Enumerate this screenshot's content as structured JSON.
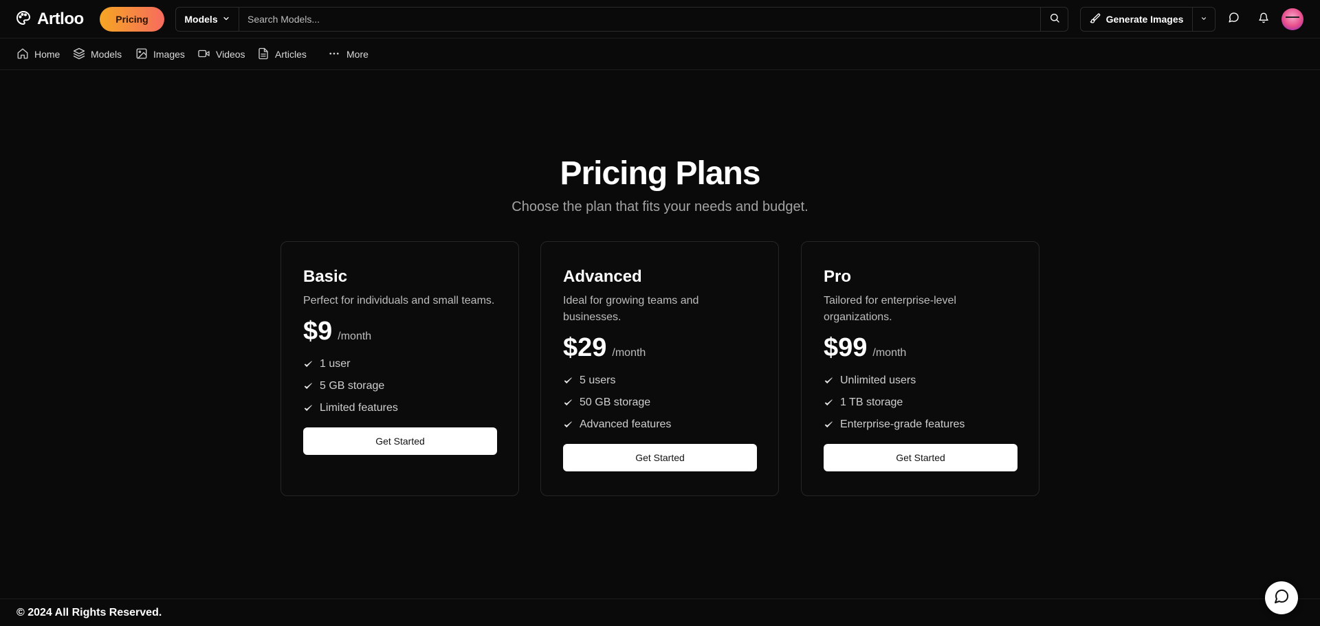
{
  "brand": {
    "name": "Artloo",
    "logo_icon": "palette-icon"
  },
  "header": {
    "pricing_label": "Pricing",
    "search": {
      "scope": "Models",
      "placeholder": "Search Models..."
    },
    "generate_label": "Generate Images",
    "icons": [
      "search-icon",
      "brush-icon",
      "chevron-down-icon",
      "chat-icon",
      "bell-icon",
      "avatar"
    ]
  },
  "nav": {
    "items": [
      {
        "label": "Home",
        "icon": "home-icon"
      },
      {
        "label": "Models",
        "icon": "layers-icon"
      },
      {
        "label": "Images",
        "icon": "image-icon"
      },
      {
        "label": "Videos",
        "icon": "video-icon"
      },
      {
        "label": "Articles",
        "icon": "document-icon"
      },
      {
        "label": "More",
        "icon": "more-dots-icon"
      }
    ]
  },
  "main": {
    "title": "Pricing Plans",
    "subtitle": "Choose the plan that fits your needs and budget.",
    "plans": [
      {
        "name": "Basic",
        "description": "Perfect for individuals and small teams.",
        "price": "$9",
        "period": "/month",
        "features": [
          "1 user",
          "5 GB storage",
          "Limited features"
        ],
        "cta": "Get Started"
      },
      {
        "name": "Advanced",
        "description": "Ideal for growing teams and businesses.",
        "price": "$29",
        "period": "/month",
        "features": [
          "5 users",
          "50 GB storage",
          "Advanced features"
        ],
        "cta": "Get Started"
      },
      {
        "name": "Pro",
        "description": "Tailored for enterprise-level organizations.",
        "price": "$99",
        "period": "/month",
        "features": [
          "Unlimited users",
          "1 TB storage",
          "Enterprise-grade features"
        ],
        "cta": "Get Started"
      }
    ]
  },
  "footer": {
    "text": "© 2024 All Rights Reserved."
  },
  "colors": {
    "background": "#0a0a0a",
    "pill_gradient_start": "#f5a623",
    "pill_gradient_end": "#f76b5e",
    "cta_bg": "#ffffff"
  }
}
